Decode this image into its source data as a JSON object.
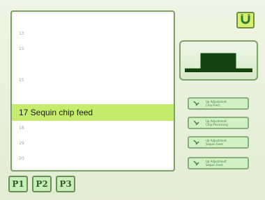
{
  "list": {
    "rows": [
      {
        "number": "13"
      },
      {
        "number": "15"
      },
      {
        "number": "15"
      },
      {
        "number": "18"
      },
      {
        "number": "19"
      },
      {
        "number": "20"
      }
    ],
    "selected_label": "17 Sequin chip feed"
  },
  "pages": [
    "P1",
    "P2",
    "P3"
  ],
  "top_button": {
    "icon": "magnet-icon"
  },
  "waveform": {
    "icon": "pulse-waveform-icon"
  },
  "adjust_buttons": [
    {
      "label_line1": "Up Adjustment",
      "label_line2": "Chip Feed"
    },
    {
      "label_line1": "Up Adjustment",
      "label_line2": "Chip Processing"
    },
    {
      "label_line1": "Up Adjustment",
      "label_line2": "Sequin Feed"
    },
    {
      "label_line1": "Up Adjustment",
      "label_line2": "Sequin Feed"
    }
  ],
  "colors": {
    "selected_row": "#c5ec6c",
    "page_buttons": "#c7eeb8",
    "accent": "#d7f06e"
  }
}
